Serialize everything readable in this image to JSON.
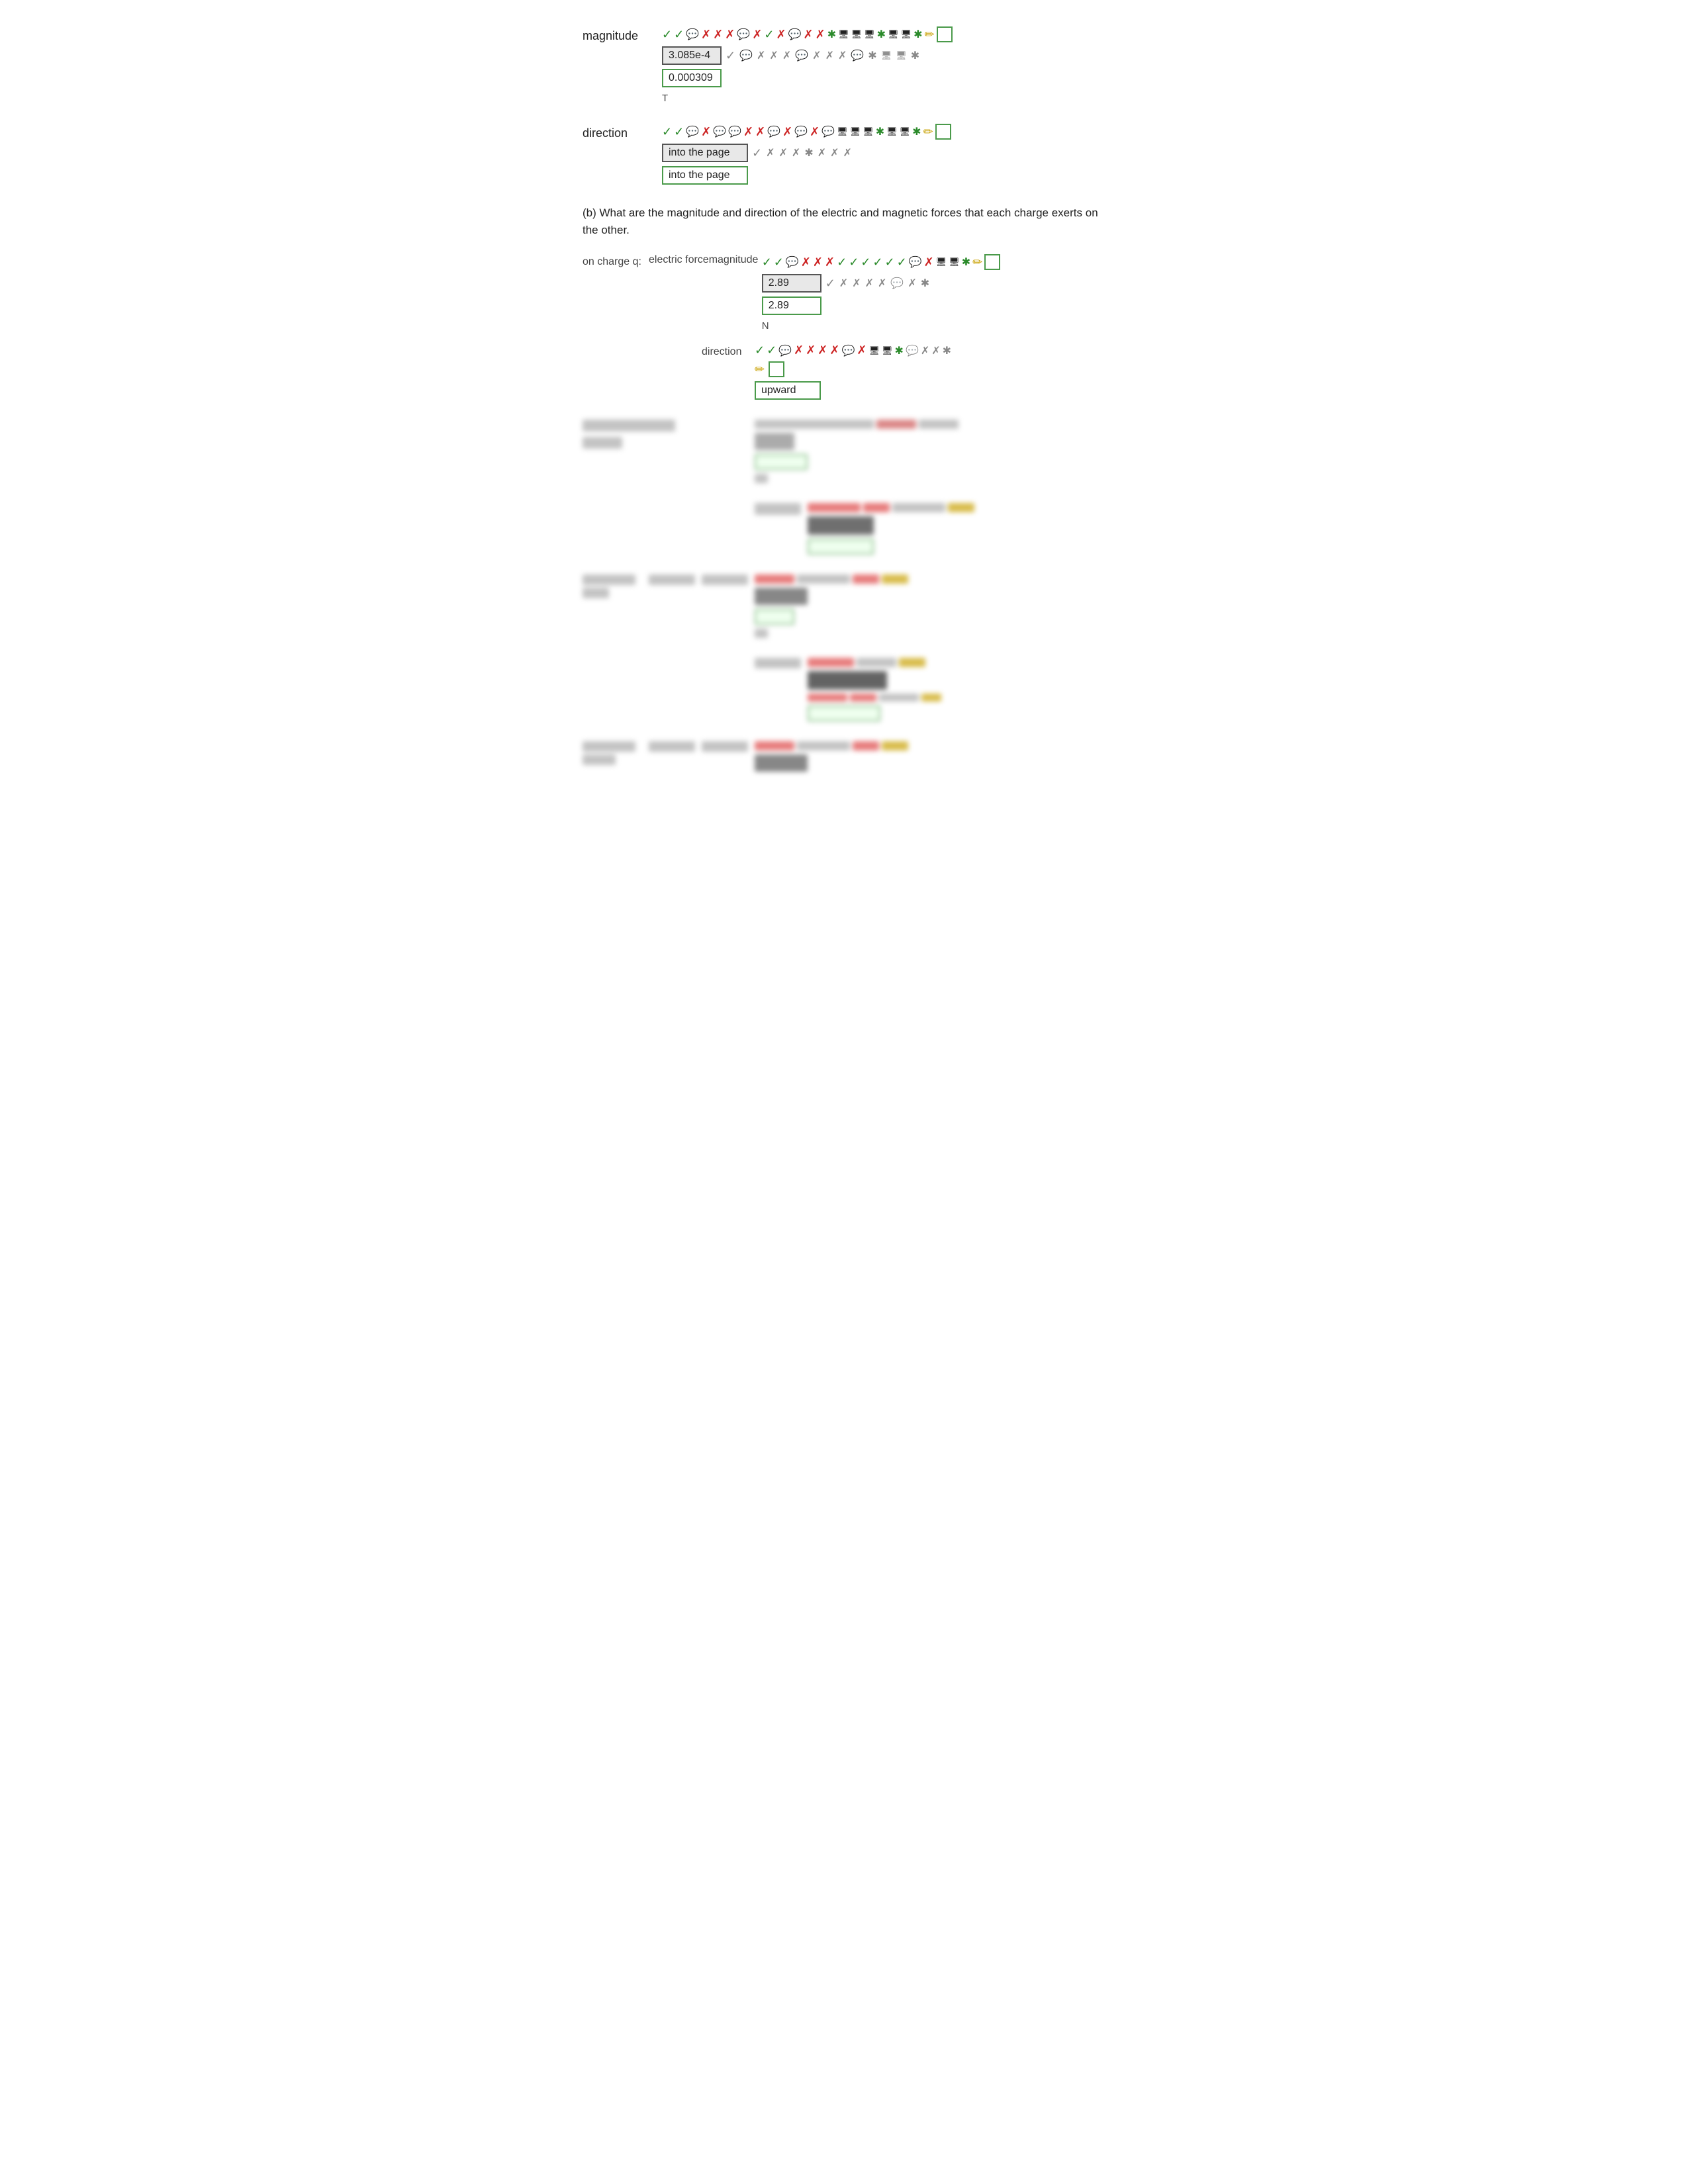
{
  "magnitude_section": {
    "label": "magnitude",
    "input_value": "3.085e-4",
    "answer_value": "0.000309",
    "unit": "T"
  },
  "direction_section": {
    "label": "direction",
    "input_value": "into the page",
    "answer_value": "into the page"
  },
  "part_b": {
    "question": "(b) What are the magnitude and direction of the electric and magnetic forces that each charge exerts on the other."
  },
  "on_charge_q": {
    "charge_label": "on charge q:",
    "force_label": "electric force",
    "magnitude_label": "magnitude",
    "direction_label": "direction",
    "magnitude_input": "2.89",
    "magnitude_answer": "2.89",
    "magnitude_unit": "N",
    "direction_input": "upward",
    "direction_answer": "upward"
  },
  "icons": {
    "checks": "✓✓",
    "speech": "💬",
    "x_red": "✗✗✗✗",
    "x_gray": "✗✗✗",
    "asterisk": "***",
    "computer": "🖥🖥🖥",
    "pencil": "✏"
  }
}
